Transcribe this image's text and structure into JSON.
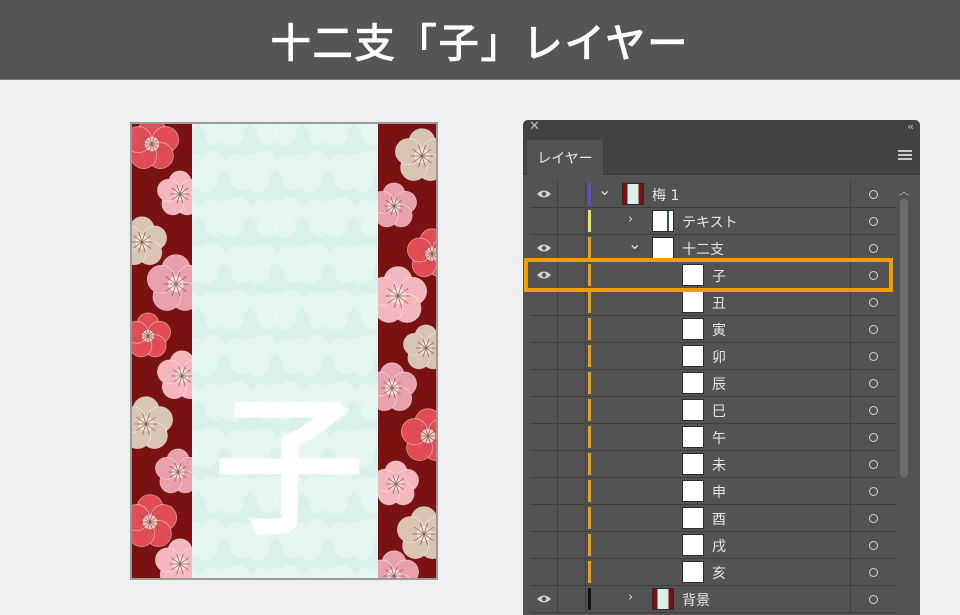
{
  "header": {
    "title": "十二支「子」レイヤー"
  },
  "artwork": {
    "character": "子"
  },
  "panel": {
    "tab_label": "レイヤー",
    "close_glyph": "✕",
    "collapse_glyph": "‹‹",
    "layers": [
      {
        "name": "梅 1",
        "visible": true,
        "expanded": true,
        "indent": 0,
        "color": "#5a4fcf",
        "thumb": "pattern"
      },
      {
        "name": "テキスト",
        "visible": false,
        "expanded": false,
        "indent": 1,
        "color": "#e6e64d",
        "thumb": "text"
      },
      {
        "name": "十二支",
        "visible": true,
        "expanded": true,
        "indent": 1,
        "color": "#f39c00",
        "thumb": "blank"
      },
      {
        "name": "子",
        "visible": true,
        "indent": 2,
        "color": "#f39c00",
        "thumb": "blank",
        "highlighted": true
      },
      {
        "name": "丑",
        "visible": false,
        "indent": 2,
        "color": "#f39c00",
        "thumb": "blank"
      },
      {
        "name": "寅",
        "visible": false,
        "indent": 2,
        "color": "#f39c00",
        "thumb": "blank"
      },
      {
        "name": "卯",
        "visible": false,
        "indent": 2,
        "color": "#f39c00",
        "thumb": "blank"
      },
      {
        "name": "辰",
        "visible": false,
        "indent": 2,
        "color": "#f39c00",
        "thumb": "blank"
      },
      {
        "name": "巳",
        "visible": false,
        "indent": 2,
        "color": "#f39c00",
        "thumb": "blank"
      },
      {
        "name": "午",
        "visible": false,
        "indent": 2,
        "color": "#f39c00",
        "thumb": "blank"
      },
      {
        "name": "未",
        "visible": false,
        "indent": 2,
        "color": "#f39c00",
        "thumb": "blank"
      },
      {
        "name": "申",
        "visible": false,
        "indent": 2,
        "color": "#f39c00",
        "thumb": "blank"
      },
      {
        "name": "酉",
        "visible": false,
        "indent": 2,
        "color": "#f39c00",
        "thumb": "blank"
      },
      {
        "name": "戌",
        "visible": false,
        "indent": 2,
        "color": "#f39c00",
        "thumb": "blank"
      },
      {
        "name": "亥",
        "visible": false,
        "indent": 2,
        "color": "#f39c00",
        "thumb": "blank"
      },
      {
        "name": "背景",
        "visible": true,
        "expanded": false,
        "indent": 1,
        "color": "#111111",
        "thumb": "pattern"
      }
    ]
  },
  "colors": {
    "highlight": "#f39c00",
    "header_bg": "#555555",
    "panel_bg": "#535353"
  },
  "icons": {
    "visibility": "eye-icon",
    "target": "target-circle-icon",
    "expand": "chevron-icon",
    "menu": "hamburger-menu-icon"
  }
}
